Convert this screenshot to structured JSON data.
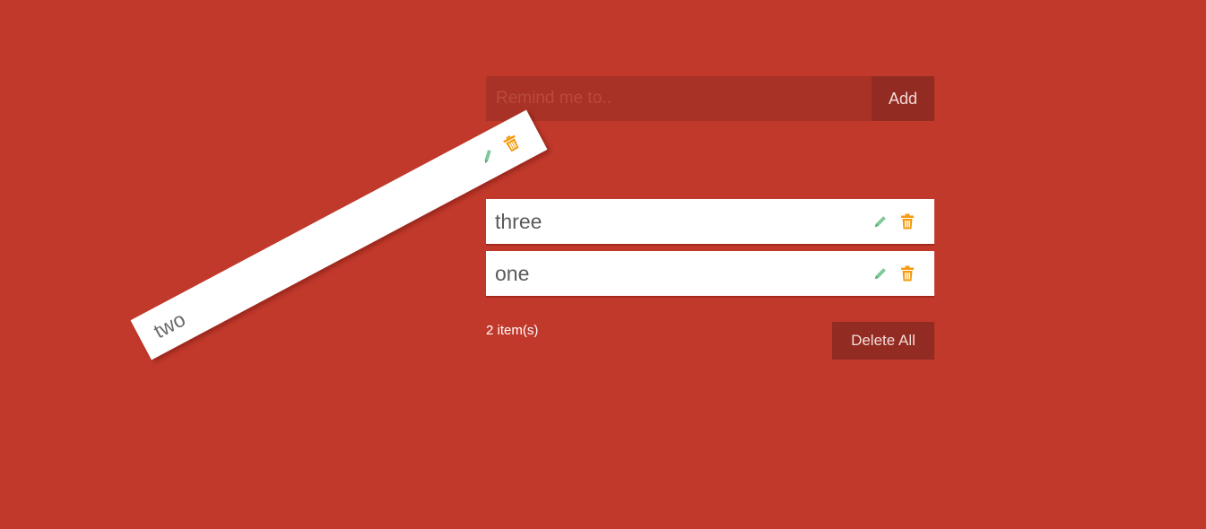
{
  "add_bar": {
    "placeholder": "Remind me to..",
    "value": "",
    "button_label": "Add"
  },
  "dragged_item": {
    "text": "two",
    "edit_icon": "pencil-icon",
    "delete_icon": "trash-icon"
  },
  "items": [
    {
      "text": "three",
      "edit_icon": "pencil-icon",
      "delete_icon": "trash-icon"
    },
    {
      "text": "one",
      "edit_icon": "pencil-icon",
      "delete_icon": "trash-icon"
    }
  ],
  "footer": {
    "count_label": "2 item(s)",
    "delete_all_label": "Delete All"
  },
  "colors": {
    "background": "#c0392b",
    "input_bg": "#a93226",
    "button_bg": "#922b21",
    "edit_icon": "#7fc89a",
    "delete_icon": "#f39c12"
  }
}
